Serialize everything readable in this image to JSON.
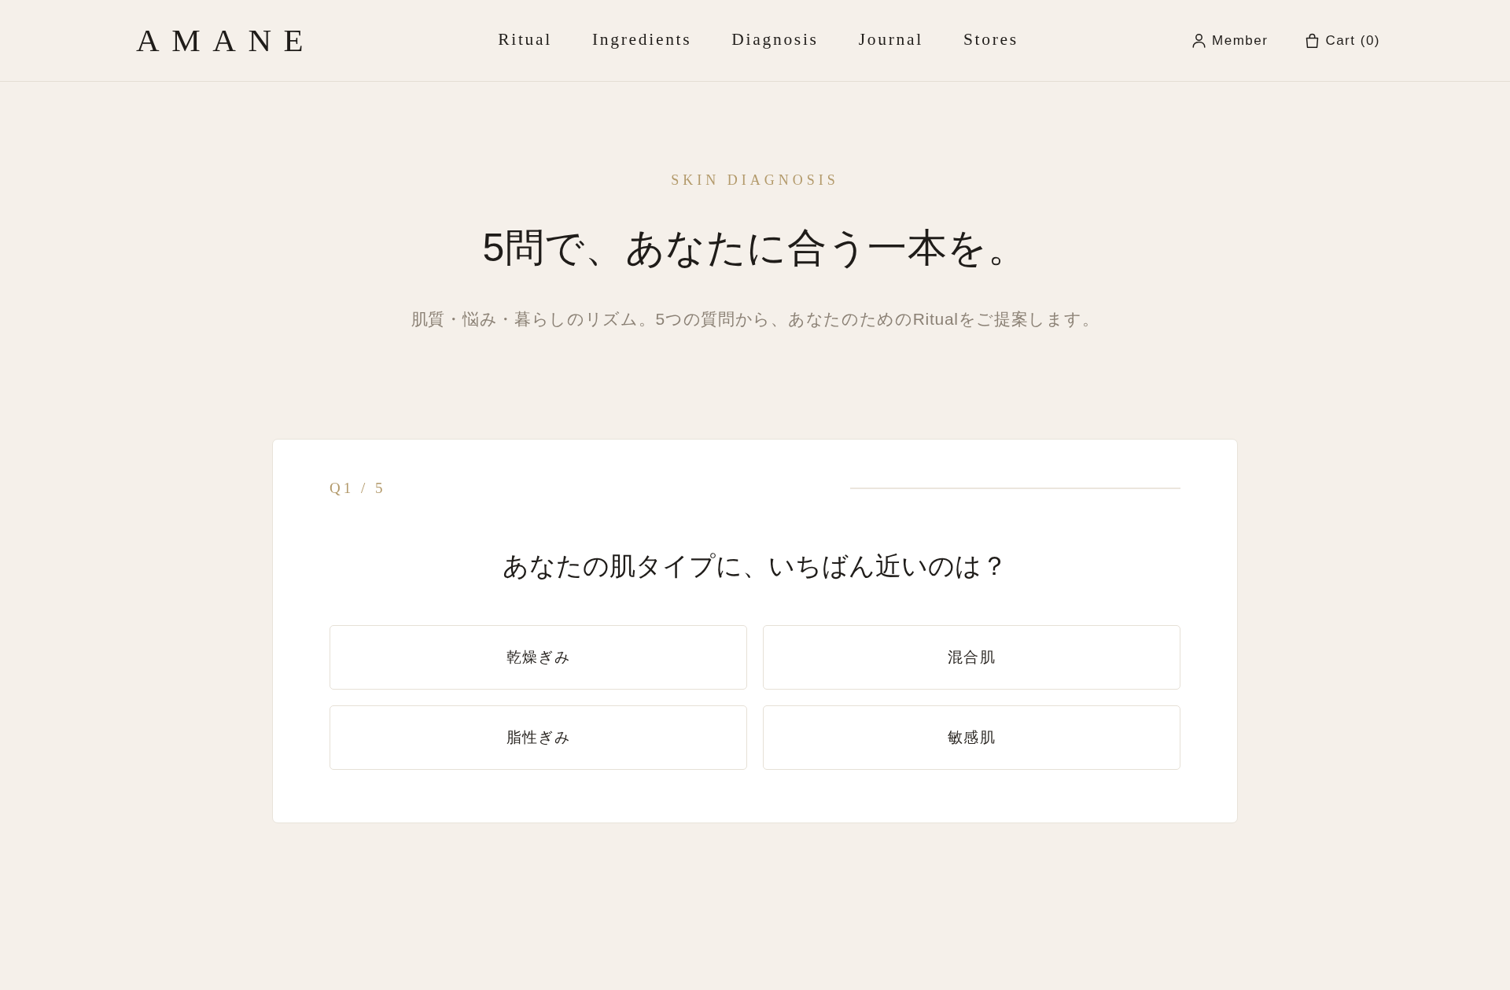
{
  "header": {
    "logo": "AMANE",
    "nav": [
      {
        "label": "Ritual"
      },
      {
        "label": "Ingredients"
      },
      {
        "label": "Diagnosis"
      },
      {
        "label": "Journal"
      },
      {
        "label": "Stores"
      }
    ],
    "member": {
      "label": "Member"
    },
    "cart": {
      "label": "Cart (0)"
    }
  },
  "hero": {
    "eyebrow": "SKIN DIAGNOSIS",
    "title": "5問で、あなたに合う一本を。",
    "subtitle": "肌質・悩み・暮らしのリズム。5つの質問から、あなたのためのRitualをご提案します。"
  },
  "quiz": {
    "step": "Q1 / 5",
    "question": "あなたの肌タイプに、いちばん近いのは？",
    "options": [
      {
        "label": "乾燥ぎみ",
        "selected": false
      },
      {
        "label": "混合肌",
        "selected": false
      },
      {
        "label": "脂性ぎみ",
        "selected": false
      },
      {
        "label": "敏感肌",
        "selected": false
      }
    ]
  }
}
